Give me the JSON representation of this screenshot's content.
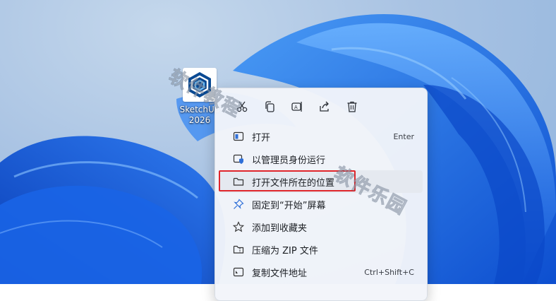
{
  "desktop": {
    "icon": {
      "name_line1": "SketchUp",
      "name_line2": "2026",
      "logo_icon": "sketchup-logo-icon"
    }
  },
  "quick_actions": [
    {
      "name": "cut",
      "icon": "scissors-icon"
    },
    {
      "name": "copy",
      "icon": "copy-icon"
    },
    {
      "name": "rename",
      "icon": "rename-icon"
    },
    {
      "name": "share",
      "icon": "share-icon"
    },
    {
      "name": "delete",
      "icon": "trash-icon"
    }
  ],
  "menu": {
    "items": [
      {
        "label": "打开",
        "shortcut": "Enter",
        "icon": "open-app-icon"
      },
      {
        "label": "以管理员身份运行",
        "shortcut": "",
        "icon": "shield-admin-icon"
      },
      {
        "label": "打开文件所在的位置",
        "shortcut": "",
        "icon": "folder-icon",
        "highlighted": true
      },
      {
        "label": "固定到“开始”屏幕",
        "shortcut": "",
        "icon": "pin-icon"
      },
      {
        "label": "添加到收藏夹",
        "shortcut": "",
        "icon": "star-icon"
      },
      {
        "label": "压缩为 ZIP 文件",
        "shortcut": "",
        "icon": "zip-folder-icon"
      },
      {
        "label": "复制文件地址",
        "shortcut": "Ctrl+Shift+C",
        "icon": "copy-path-icon"
      }
    ]
  },
  "watermark": {
    "text1": "软件教程",
    "text2": "软件乐园"
  },
  "colors": {
    "highlight_border": "#e0262b",
    "wallpaper_blue": "#1f6fe8",
    "menu_bg": "#f3f5fa"
  }
}
